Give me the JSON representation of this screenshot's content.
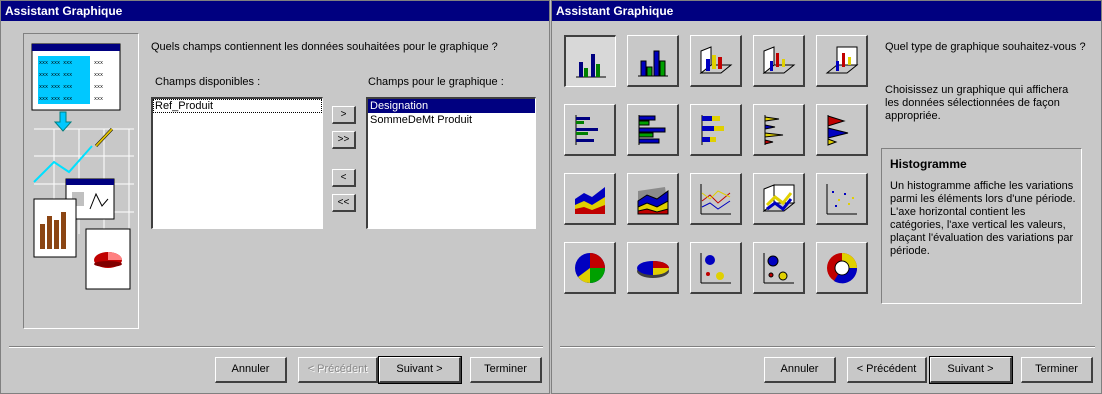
{
  "left": {
    "title": "Assistant Graphique",
    "question": "Quels champs contiennent les données souhaitées pour le graphique ?",
    "available_label": "Champs disponibles :",
    "chart_fields_label": "Champs pour le graphique :",
    "available_fields": [
      "Ref_Produit"
    ],
    "chart_fields": [
      "Designation",
      "SommeDeMt Produit"
    ],
    "move": {
      "add": ">",
      "add_all": ">>",
      "remove": "<",
      "remove_all": "<<"
    },
    "illustration_grid": "xxx xxx xxx xxx",
    "buttons": {
      "cancel": "Annuler",
      "previous": "< Précédent",
      "next": "Suivant >",
      "finish": "Terminer"
    }
  },
  "right": {
    "title": "Assistant Graphique",
    "question": "Quel type de graphique souhaitez-vous ?",
    "hint": "Choisissez un graphique qui affichera les données sélectionnées de façon appropriée.",
    "selected_type": "Histogramme",
    "description": "Un histogramme affiche les variations parmi les éléments lors d'une période. L'axe horizontal contient les catégories, l'axe vertical les valeurs, plaçant l'évaluation des variations par période.",
    "chart_types": [
      [
        "column-2d-icon",
        "column-3d-icon",
        "column-3d-clustered-icon",
        "column-3d-perspective-icon",
        "column-3d-deep-icon"
      ],
      [
        "bar-2d-icon",
        "bar-3d-icon",
        "bar-stacked-icon",
        "bar-cone-icon",
        "bar-pyramid-icon"
      ],
      [
        "area-2d-icon",
        "area-3d-icon",
        "line-2d-icon",
        "line-3d-icon",
        "scatter-icon"
      ],
      [
        "pie-2d-icon",
        "pie-3d-icon",
        "bubble-icon",
        "bubble-3d-icon",
        "doughnut-icon"
      ]
    ],
    "buttons": {
      "cancel": "Annuler",
      "previous": "< Précédent",
      "next": "Suivant >",
      "finish": "Terminer"
    }
  },
  "colors": {
    "titlebar": "#000080",
    "selection": "#000080",
    "dialog": "#c8c8c8"
  }
}
